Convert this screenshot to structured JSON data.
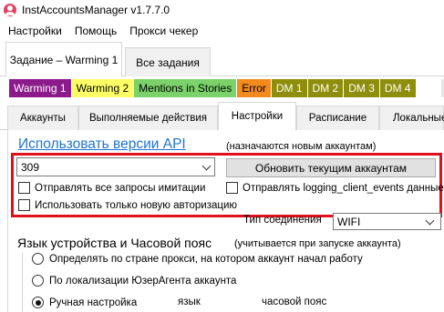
{
  "window": {
    "title": "InstAccountsManager v1.7.7.0",
    "icon": "instagram-profile-icon"
  },
  "menu": {
    "items": [
      "Настройки",
      "Помощь",
      "Прокси чекер"
    ]
  },
  "outer_tabs": {
    "active": "Задание – Warming 1",
    "inactive": "Все задания"
  },
  "color_tabs": [
    {
      "label": "Warming 1",
      "bg": "#8b1a8b",
      "fg": "#ffffff"
    },
    {
      "label": "Warming 2",
      "bg": "#ffff66",
      "fg": "#000000"
    },
    {
      "label": "Mentions in Stories",
      "bg": "#7bd16a",
      "fg": "#000000"
    },
    {
      "label": "Error",
      "bg": "#f28a1e",
      "fg": "#000000"
    },
    {
      "label": "DM 1",
      "bg": "#8e8e0c",
      "fg": "#ffffff"
    },
    {
      "label": "DM 2",
      "bg": "#8e8e0c",
      "fg": "#ffffff"
    },
    {
      "label": "DM 3",
      "bg": "#8e8e0c",
      "fg": "#ffffff"
    },
    {
      "label": "DM 4",
      "bg": "#8e8e0c",
      "fg": "#ffffff"
    }
  ],
  "inner_tabs": {
    "items": [
      "Аккаунты",
      "Выполняемые действия",
      "Настройки",
      "Расписание",
      "Локальные"
    ],
    "active_index": 2
  },
  "api": {
    "heading": "Использовать версии API",
    "note": "(назначаются новым аккаунтам)",
    "version_value": "309",
    "update_button": "Обновить текущим аккаунтам",
    "checkbox_imitation": "Отправлять все запросы имитации",
    "checkbox_logging": "Отправлять logging_client_events данные",
    "checkbox_new_auth": "Использовать только новую авторизацию"
  },
  "connection": {
    "label": "Тип соединения",
    "value": "WIFI"
  },
  "language": {
    "heading": "Язык устройства и Часовой пояс",
    "note": "(учитывается при запуске аккаунта)",
    "option_proxy": "Определять по стране прокси, на котором аккаунт начал работу",
    "option_useragent": "По локализации ЮзерАгента аккаунта",
    "option_manual": "Ручная настройка",
    "manual_lang_label": "язык",
    "manual_tz_label": "часовой пояс",
    "selected": "manual"
  },
  "colors": {
    "accent_link": "#1e73d2",
    "highlight_frame": "#e0101d"
  }
}
